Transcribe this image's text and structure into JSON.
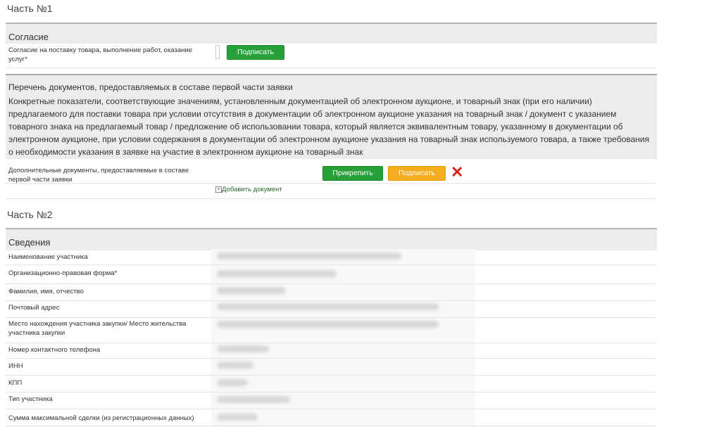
{
  "part1": {
    "title": "Часть №1",
    "consent": {
      "title": "Согласие",
      "label": "Согласие на поставку товара, выполнение работ, оказание услуг*",
      "sign_button": "Подписать"
    },
    "documents": {
      "title": "Перечень документов, предоставляемых в составе первой части заявки",
      "description": "Конкретные показатели, соответствующие значениям, установленным документацией об электронном аукционе, и товарный знак (при его наличии) предлагаемого для поставки товара при условии отсутствия в документации об электронном аукционе указания на товарный знак / документ с указанием товарного знака на предлагаемый товар / предложение об использовании товара, который является эквивалентным товару, указанному в документации об электронном аукционе, при условии содержания в документации об электронном аукционе указания на товарный знак используемого товара, а также требования о необходимости указания в заявке на участие в электронном аукционе на товарный знак",
      "additional_label": "Дополнительные документы, предоставляемые в составе первой части заявки",
      "attach_button": "Прикрепить",
      "sign_button": "Подписать",
      "add_document": "Добавить документ",
      "add_icon": "plus-square-icon",
      "delete_icon": "close-icon"
    }
  },
  "part2": {
    "title": "Часть №2",
    "info_title": "Сведения",
    "fields": [
      {
        "label": "Наименование участника"
      },
      {
        "label": "Организационно-правовая форма*"
      },
      {
        "label": "Фамилия, имя, отчество"
      },
      {
        "label": "Почтовый адрес"
      },
      {
        "label": "Место нахождения участника закупки/ Место жительства участника закупки"
      },
      {
        "label": "Номер контактного телефона"
      },
      {
        "label": "ИНН"
      },
      {
        "label": "КПП"
      },
      {
        "label": "Тип участника"
      },
      {
        "label": "Сумма максимальной сделки (из регистрационных данных)"
      }
    ]
  },
  "colors": {
    "green": "#27a03a",
    "orange": "#f6ac1f",
    "delete": "#d9231b",
    "section_bg": "#ececec"
  }
}
